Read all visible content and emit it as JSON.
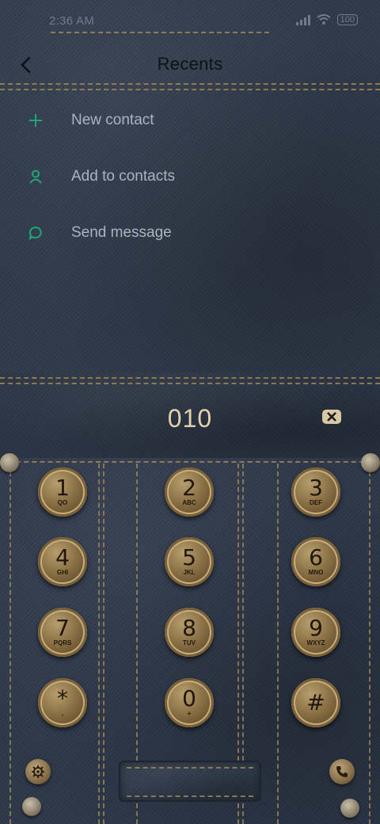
{
  "status_bar": {
    "time": "2:36 AM",
    "battery": "100"
  },
  "header": {
    "title": "Recents"
  },
  "menu": [
    {
      "label": "New contact",
      "icon": "plus-icon"
    },
    {
      "label": "Add to contacts",
      "icon": "person-icon"
    },
    {
      "label": "Send message",
      "icon": "chat-bubble-icon"
    }
  ],
  "dialer": {
    "number": "010"
  },
  "keys": [
    {
      "digit": "1",
      "letters": "QO"
    },
    {
      "digit": "2",
      "letters": "ABC"
    },
    {
      "digit": "3",
      "letters": "DEF"
    },
    {
      "digit": "4",
      "letters": "GHI"
    },
    {
      "digit": "5",
      "letters": "JKL"
    },
    {
      "digit": "6",
      "letters": "MNO"
    },
    {
      "digit": "7",
      "letters": "PQRS"
    },
    {
      "digit": "8",
      "letters": "TUV"
    },
    {
      "digit": "9",
      "letters": "WXYZ"
    },
    {
      "digit": "*",
      "letters": ","
    },
    {
      "digit": "0",
      "letters": "+"
    },
    {
      "digit": "#",
      "letters": ""
    }
  ],
  "colors": {
    "accent": "#1fa77a",
    "brass": "#a58a57",
    "number": "#e3d2ac"
  }
}
